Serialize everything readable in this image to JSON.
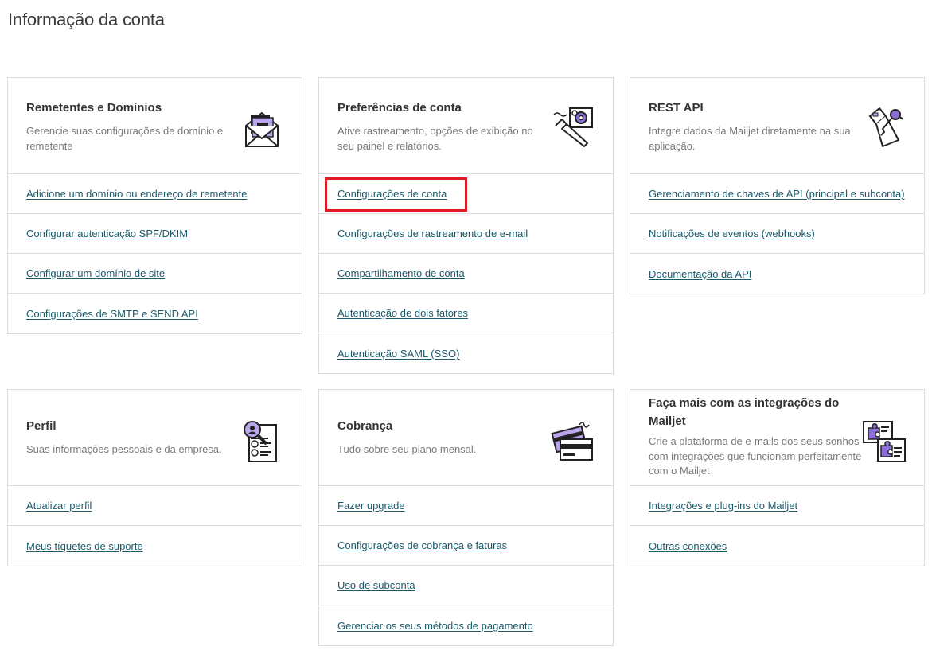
{
  "page": {
    "title": "Informação da conta"
  },
  "cards": {
    "senders": {
      "title": "Remetentes e Domínios",
      "desc": "Gerencie suas configurações de domínio e remetente",
      "links": [
        "Adicione um domínio ou endereço de remetente",
        "Configurar autenticação SPF/DKIM",
        "Configurar um domínio de site",
        "Configurações de SMTP e SEND API"
      ]
    },
    "prefs": {
      "title": "Preferências de conta",
      "desc": "Ative rastreamento, opções de exibição no seu painel e relatórios.",
      "links": [
        "Configurações de conta",
        "Configurações de rastreamento de e-mail",
        "Compartilhamento de conta",
        "Autenticação de dois fatores",
        "Autenticação SAML (SSO)"
      ]
    },
    "api": {
      "title": "REST API",
      "desc": "Integre dados da Mailjet diretamente na sua aplicação.",
      "links": [
        "Gerenciamento de chaves de API (principal e subconta)",
        "Notificações de eventos (webhooks)",
        "Documentação da API"
      ]
    },
    "profile": {
      "title": "Perfil",
      "desc": "Suas informações pessoais e da empresa.",
      "links": [
        "Atualizar perfil",
        "Meus tíquetes de suporte"
      ]
    },
    "billing": {
      "title": "Cobrança",
      "desc": "Tudo sobre seu plano mensal.",
      "links": [
        "Fazer upgrade",
        "Configurações de cobrança e faturas",
        "Uso de subconta",
        "Gerenciar os seus métodos de pagamento"
      ]
    },
    "integrations": {
      "title": "Faça mais com as integrações do Mailjet",
      "desc": "Crie a plataforma de e-mails dos seus sonhos com integrações que funcionam perfeitamente com o Mailjet",
      "links": [
        "Integrações e plug-ins do Mailjet",
        "Outras conexões"
      ]
    }
  },
  "icons": {
    "senders": "envelope-icon",
    "prefs": "wrench-gear-icon",
    "api": "keys-icon",
    "profile": "profile-magnifier-icon",
    "billing": "credit-card-icon",
    "integrations": "puzzle-cards-icon"
  },
  "colors": {
    "accent": "#8b6fd6",
    "link": "#1a5a6b",
    "highlight": "#e01b24",
    "border": "#dcdcdc"
  }
}
